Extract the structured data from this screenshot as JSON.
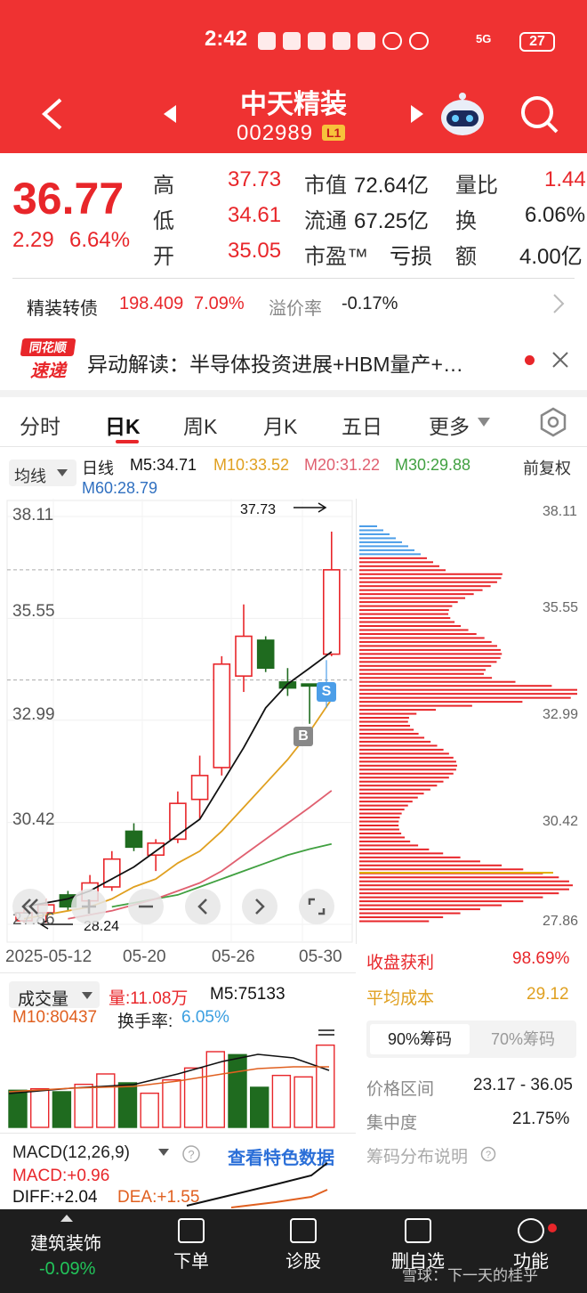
{
  "status": {
    "time": "2:42",
    "signal": "5G",
    "battery": "27"
  },
  "header": {
    "title": "中天精装",
    "code": "002989",
    "level": "L1"
  },
  "quote": {
    "price": "36.77",
    "change": "2.29",
    "pct": "6.64%",
    "high_label": "高",
    "high": "37.73",
    "low_label": "低",
    "low": "34.61",
    "open_label": "开",
    "open": "35.05",
    "mcap_label": "市值",
    "mcap": "72.64亿",
    "float_label": "流通",
    "float": "67.25亿",
    "pe_label": "市盈™",
    "pe": "亏损",
    "vr_label": "量比",
    "vr": "1.44",
    "turn_label": "换",
    "turn": "6.06%",
    "amt_label": "额",
    "amt": "4.00亿"
  },
  "bond": {
    "name": "精装转债",
    "price": "198.409",
    "pct": "7.09%",
    "prem_label": "溢价率",
    "prem": "-0.17%"
  },
  "news": {
    "badge1": "同花顺",
    "badge2": "速递",
    "text": "异动解读：半导体投资进展+HBM量产+…"
  },
  "tabs": [
    "分时",
    "日K",
    "周K",
    "月K",
    "五日",
    "更多"
  ],
  "ma": {
    "btn": "均线",
    "label": "日线",
    "m5": "M5:34.71",
    "m10": "M10:33.52",
    "m20": "M20:31.22",
    "m30": "M30:29.88",
    "m60": "M60:28.79",
    "adj": "前复权"
  },
  "axis": {
    "y": [
      "38.11",
      "35.55",
      "32.99",
      "30.42",
      "27.86"
    ],
    "x": [
      "2025-05-12",
      "05-20",
      "05-26",
      "05-30"
    ],
    "hi_mark": "37.73",
    "lo_mark": "28.24",
    "s": "S",
    "b": "B"
  },
  "chips": {
    "profit_label": "收盘获利",
    "profit": "98.69%",
    "cost_label": "平均成本",
    "cost": "29.12",
    "tab90": "90%筹码",
    "tab70": "70%筹码",
    "range_label": "价格区间",
    "range": "23.17 - 36.05",
    "conc_label": "集中度",
    "conc": "21.75%",
    "explain": "筹码分布说明"
  },
  "vol": {
    "title": "成交量",
    "vol": "量:11.08万",
    "m5": "M5:75133",
    "m10": "M10:80437",
    "turn_label": "换手率:",
    "turn": "6.05%"
  },
  "macd": {
    "title": "MACD(12,26,9)",
    "link": "查看特色数据",
    "macd": "MACD:+0.96",
    "diff": "DIFF:+2.04",
    "dea": "DEA:+1.55"
  },
  "bottom": {
    "sector": "建筑装饰",
    "sector_pct": "-0.09%",
    "order": "下单",
    "diag": "诊股",
    "del": "删自选",
    "func": "功能",
    "watermark": "雪球：下一天的桂乎"
  },
  "colors": {
    "up": "#e8262a",
    "down": "#1f6b1f",
    "ma5": "#111111",
    "ma10": "#e0a020",
    "ma20": "#e06070",
    "ma30": "#40a040",
    "ma60": "#3070c0",
    "header": "#ef3232"
  },
  "chart_data": {
    "type": "candlestick",
    "dates": [
      "05-12",
      "05-13",
      "05-14",
      "05-15",
      "05-16",
      "05-19",
      "05-20",
      "05-21",
      "05-22",
      "05-23",
      "05-26",
      "05-27",
      "05-28",
      "05-29",
      "05-30"
    ],
    "ohlc": [
      [
        27.95,
        28.24,
        27.9,
        28.15
      ],
      [
        28.15,
        28.5,
        27.9,
        28.35
      ],
      [
        28.6,
        28.7,
        28.2,
        28.3
      ],
      [
        28.45,
        29.1,
        28.3,
        28.9
      ],
      [
        28.8,
        29.7,
        28.7,
        29.5
      ],
      [
        30.2,
        30.4,
        29.7,
        29.8
      ],
      [
        29.6,
        30.0,
        29.2,
        29.9
      ],
      [
        30.0,
        31.2,
        29.9,
        30.9
      ],
      [
        31.0,
        32.1,
        30.5,
        31.6
      ],
      [
        31.8,
        34.6,
        31.6,
        34.4
      ],
      [
        34.1,
        35.9,
        33.7,
        35.1
      ],
      [
        35.0,
        35.1,
        34.2,
        34.3
      ],
      [
        33.95,
        34.3,
        33.6,
        33.8
      ],
      [
        33.9,
        33.9,
        32.9,
        33.85
      ],
      [
        34.65,
        37.73,
        34.6,
        36.77
      ]
    ],
    "ma5": [
      28.3,
      28.4,
      28.5,
      28.7,
      29.0,
      29.3,
      29.7,
      30.1,
      30.5,
      31.4,
      32.3,
      33.3,
      33.9,
      34.3,
      34.71
    ],
    "ma10": [
      28.0,
      28.1,
      28.2,
      28.3,
      28.5,
      28.8,
      29.0,
      29.4,
      29.7,
      30.2,
      30.8,
      31.4,
      32.0,
      32.7,
      33.52
    ],
    "ma20": [
      27.9,
      28.0,
      28.0,
      28.1,
      28.2,
      28.35,
      28.5,
      28.7,
      28.9,
      29.2,
      29.6,
      30.0,
      30.4,
      30.8,
      31.22
    ],
    "ma30": [
      28.0,
      28.0,
      28.1,
      28.15,
      28.3,
      28.4,
      28.5,
      28.6,
      28.8,
      29.0,
      29.2,
      29.4,
      29.6,
      29.75,
      29.88
    ],
    "ylim": [
      27.86,
      38.11
    ],
    "volume": [
      [
        50000,
        0
      ],
      [
        52000,
        1
      ],
      [
        48000,
        0
      ],
      [
        58000,
        1
      ],
      [
        72000,
        1
      ],
      [
        60000,
        0
      ],
      [
        46000,
        1
      ],
      [
        64000,
        1
      ],
      [
        80000,
        1
      ],
      [
        102000,
        1
      ],
      [
        98000,
        0
      ],
      [
        54000,
        0
      ],
      [
        70000,
        1
      ],
      [
        68000,
        1
      ],
      [
        110800,
        1
      ]
    ]
  }
}
